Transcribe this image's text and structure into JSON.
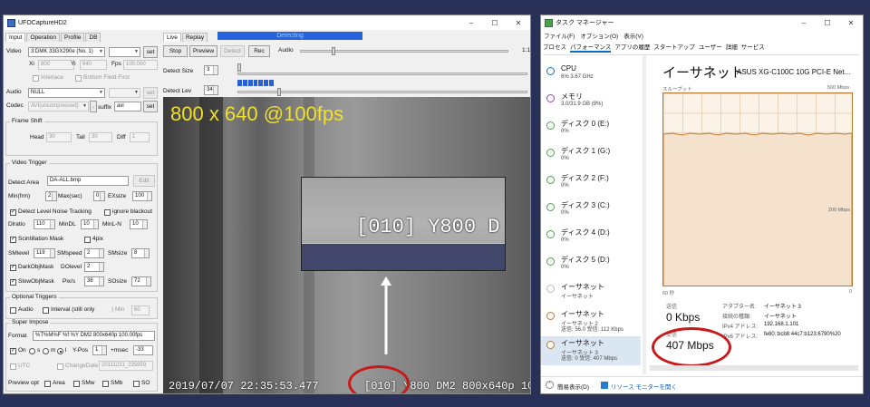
{
  "ufo": {
    "title": "UFOCaptureHD2",
    "tabs_left": [
      "Input",
      "Operation",
      "Profile",
      "DB"
    ],
    "tabs_right": [
      "Live",
      "Replay"
    ],
    "video_label": "Video",
    "video_device": "3:DMK 33GX290e (No. 1)",
    "set_label": "set",
    "xi_label": "Xi",
    "xi_value": "800",
    "yi_label": "Yi",
    "yi_value": "640",
    "fps_label": "Fps",
    "fps_value": "100.000",
    "interlace_label": "Interlace",
    "bottom_field_label": "Bottom Field First",
    "audio_label": "Audio",
    "audio_device": "NULL",
    "codec_label": "Codec",
    "codec_value": "AVI(uncompressed)",
    "suffix_label": "suffix",
    "suffix_value": "avi",
    "frame_shift": {
      "title": "Frame Shift",
      "head_label": "Head",
      "head_value": "30",
      "tail_label": "Tail",
      "tail_value": "30",
      "diff_label": "Diff",
      "diff_value": "1"
    },
    "video_trigger": {
      "title": "Video Trigger",
      "detect_area_label": "Detect Area",
      "detect_area_value": "DA-ALL.bmp",
      "edit_label": "Edit",
      "min_frm_label": "Min(frm)",
      "min_frm_value": "2",
      "max_sec_label": "Max(sec)",
      "max_sec_value": "0",
      "exsize_label": "EXsize",
      "exsize_value": "100",
      "detect_noise_label": "Detect Level Noise Tracking",
      "ignore_blackout_label": "ignore blackout",
      "dlratio_label": "Dlratio",
      "dlratio_value": "110",
      "mindl_label": "MinDL",
      "mindl_value": "10",
      "minl_label": "MinL-N",
      "minl_value": "10",
      "scint_label": "Scintillation Mask",
      "fourpix_label": "4pix",
      "smlevel_label": "SMlevel",
      "smlevel_value": "119",
      "smspeed_label": "SMspeed",
      "smspeed_value": "2",
      "smsize_label": "SMsize",
      "smsize_value": "8",
      "darkobj_label": "DarkObjMask",
      "dolevel_label": "DOlevel",
      "dolevel_value": "2",
      "slowobj_label": "SlowObjMask",
      "pixs_label": "Pix/s",
      "pixs_value": "36",
      "sosize_label": "SOsize",
      "sosize_value": "72"
    },
    "optional_triggers": {
      "title": "Optional Triggers",
      "audio_label": "Audio",
      "interval_label": "Interval (still only",
      "min_label": ") Min",
      "min_value": "60"
    },
    "super_impose": {
      "title": "Super Impose",
      "format_label": "Format",
      "format_value": "%T%M%F %f %Y DM2 800x640p 100.00fps",
      "on_label": "On",
      "s_label": "s",
      "m_label": "m",
      "l_label": "l",
      "ypos_label": "Y-Pos",
      "ypos_value": "1",
      "msec_label": "+msec",
      "msec_value": "-33",
      "utc_label": "UTC",
      "changedate_label": "ChangeDate",
      "changedate_value": "20111231_235959",
      "preview_label": "Preview opt",
      "area_label": "Area",
      "smw_label": "SMw",
      "smb_label": "SMb",
      "so_label": "SO"
    },
    "status_bar": "Detecting",
    "stop_label": "Stop",
    "preview_label": "Preview",
    "detect_btn_label": "Detect",
    "rec_label": "Rec",
    "audio_btn_label": "Audio",
    "zoom_label": "1:1",
    "detect_size_label": "Detect Size",
    "detect_size_value": "3",
    "detect_lev_label": "Detect Lev",
    "detect_lev_value": "34",
    "overlay_text": "800 x 640 @100fps",
    "zoom_caption": "[010] Y800 D",
    "timestamp": "2019/07/07 22:35:53.477",
    "bottom_caption": "[010] Y800 DM2 800x640p 10"
  },
  "tm": {
    "title": "タスク マネージャー",
    "menu": [
      "ファイル(F)",
      "オプション(O)",
      "表示(V)"
    ],
    "tabs": [
      "プロセス",
      "パフォーマンス",
      "アプリの履歴",
      "スタートアップ",
      "ユーザー",
      "詳細",
      "サービス"
    ],
    "resources": [
      {
        "name": "CPU",
        "value": "6%  3.67 GHz",
        "value2": ""
      },
      {
        "name": "メモリ",
        "value": "3.0/31.9 GB (9%)",
        "value2": ""
      },
      {
        "name": "ディスク 0 (E:)",
        "value": "0%",
        "value2": ""
      },
      {
        "name": "ディスク 1 (G:)",
        "value": "0%",
        "value2": ""
      },
      {
        "name": "ディスク 2 (F:)",
        "value": "0%",
        "value2": ""
      },
      {
        "name": "ディスク 3 (C:)",
        "value": "0%",
        "value2": ""
      },
      {
        "name": "ディスク 4 (D:)",
        "value": "0%",
        "value2": ""
      },
      {
        "name": "ディスク 5 (D:)",
        "value": "0%",
        "value2": ""
      },
      {
        "name": "イーサネット",
        "value": "イーサネット",
        "value2": ""
      },
      {
        "name": "イーサネット",
        "value": "イーサネット 2",
        "value2": "送信: 56.0  受信: 112 Kbps"
      },
      {
        "name": "イーサネット",
        "value": "イーサネット 3",
        "value2": "送信: 0  受信: 407 Mbps"
      }
    ],
    "detail_title": "イーサネット",
    "adapter_name": "ASUS XG-C100C 10G PCI-E Net...",
    "throughput_label": "スループット",
    "max_label": "500 Mbps",
    "mid_label": "200 Mbps",
    "time_label": "60 秒",
    "zero_label": "0",
    "send_label": "送信",
    "send_value": "0 Kbps",
    "recv_label": "受信",
    "recv_value": "407 Mbps",
    "info": [
      {
        "k": "アダプター名:",
        "v": "イーサネット 3"
      },
      {
        "k": "接続の種類:",
        "v": "イーサネット"
      },
      {
        "k": "IPv4 アドレス:",
        "v": "192.168.1.101"
      },
      {
        "k": "IPv6 アドレス:",
        "v": "fe80::bcb8:44c7:b123:6790%20"
      }
    ],
    "fewer_details": "簡易表示(D)",
    "resource_monitor": "リソース モニターを開く"
  },
  "colors": {
    "accent": "#0a6fc2",
    "graph": "#c07a2c",
    "annot": "#c81a1a",
    "overlay": "#f0e028"
  }
}
